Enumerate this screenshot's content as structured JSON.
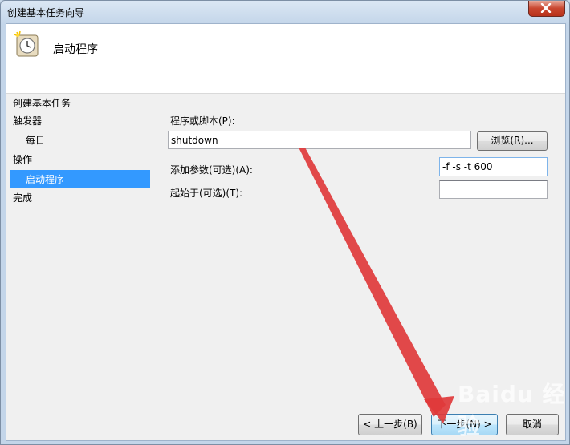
{
  "window": {
    "title": "创建基本任务向导"
  },
  "header": {
    "title": "启动程序",
    "icon": "clock-task-icon"
  },
  "sidebar": {
    "heading": "创建基本任务",
    "items": [
      {
        "label": "触发器",
        "level": 0,
        "active": false
      },
      {
        "label": "每日",
        "level": 1,
        "active": false
      },
      {
        "label": "操作",
        "level": 0,
        "active": false
      },
      {
        "label": "启动程序",
        "level": 1,
        "active": true
      },
      {
        "label": "完成",
        "level": 0,
        "active": false
      }
    ],
    "active_color": "#3399ff"
  },
  "form": {
    "program_label": "程序或脚本(P):",
    "program_value": "shutdown",
    "browse_label": "浏览(R)...",
    "args_label": "添加参数(可选)(A):",
    "args_value": "-f -s -t 600",
    "startin_label": "起始于(可选)(T):",
    "startin_value": ""
  },
  "footer": {
    "back_label": "< 上一步(B)",
    "next_label": "下一步(N) >",
    "cancel_label": "取消"
  },
  "overlay": {
    "arrow_color": "#e0393b",
    "watermark": "Baidu 经验"
  }
}
